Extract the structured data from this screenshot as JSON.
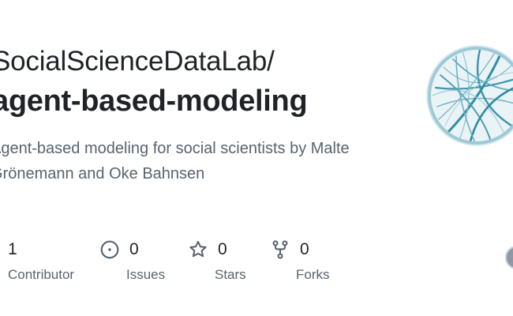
{
  "repo_card": {
    "owner": "SocialScienceDataLab/",
    "name": "agent-based-modeling",
    "description": "Agent-based modeling for social scientists by Malte Grönemann and Oke Bahnsen"
  },
  "stats": {
    "contributors": {
      "value": "1",
      "label": "Contributor",
      "icon": "people-icon"
    },
    "issues": {
      "value": "0",
      "label": "Issues",
      "icon": "issue-opened-icon"
    },
    "stars": {
      "value": "0",
      "label": "Stars",
      "icon": "star-icon"
    },
    "forks": {
      "value": "0",
      "label": "Forks",
      "icon": "repo-forked-icon"
    }
  },
  "colors": {
    "text_primary": "#1f2328",
    "text_muted": "#59636e",
    "logo_teal": "#2e8fa6"
  }
}
